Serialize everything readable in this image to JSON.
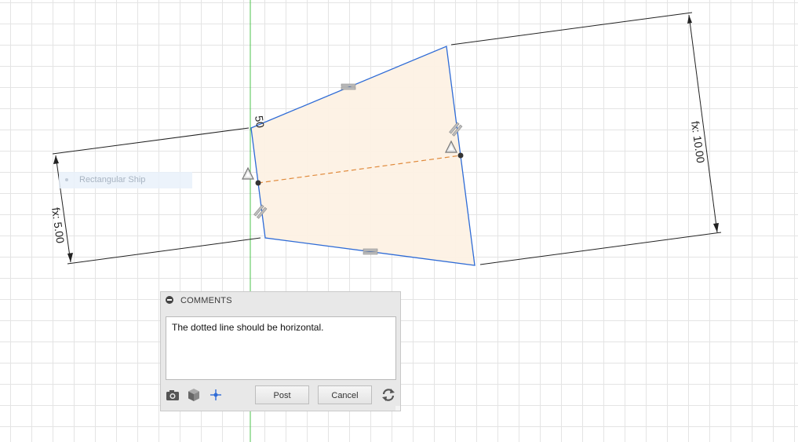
{
  "canvas": {
    "short_dimension": "fx: 5.00",
    "long_dimension": "fx: 10.00",
    "corner_dimension": "50",
    "shape_color": "#2e6bd6",
    "fill_color": "#fdf1e4",
    "dashed_line_color": "#e08a3c"
  },
  "ghost_item": {
    "label": "Rectangular Ship"
  },
  "comments": {
    "header": "COMMENTS",
    "text": "The dotted line should be horizontal.",
    "post_label": "Post",
    "cancel_label": "Cancel",
    "icons": [
      "camera-icon",
      "box-view-icon",
      "pin-icon",
      "refresh-icon"
    ]
  }
}
